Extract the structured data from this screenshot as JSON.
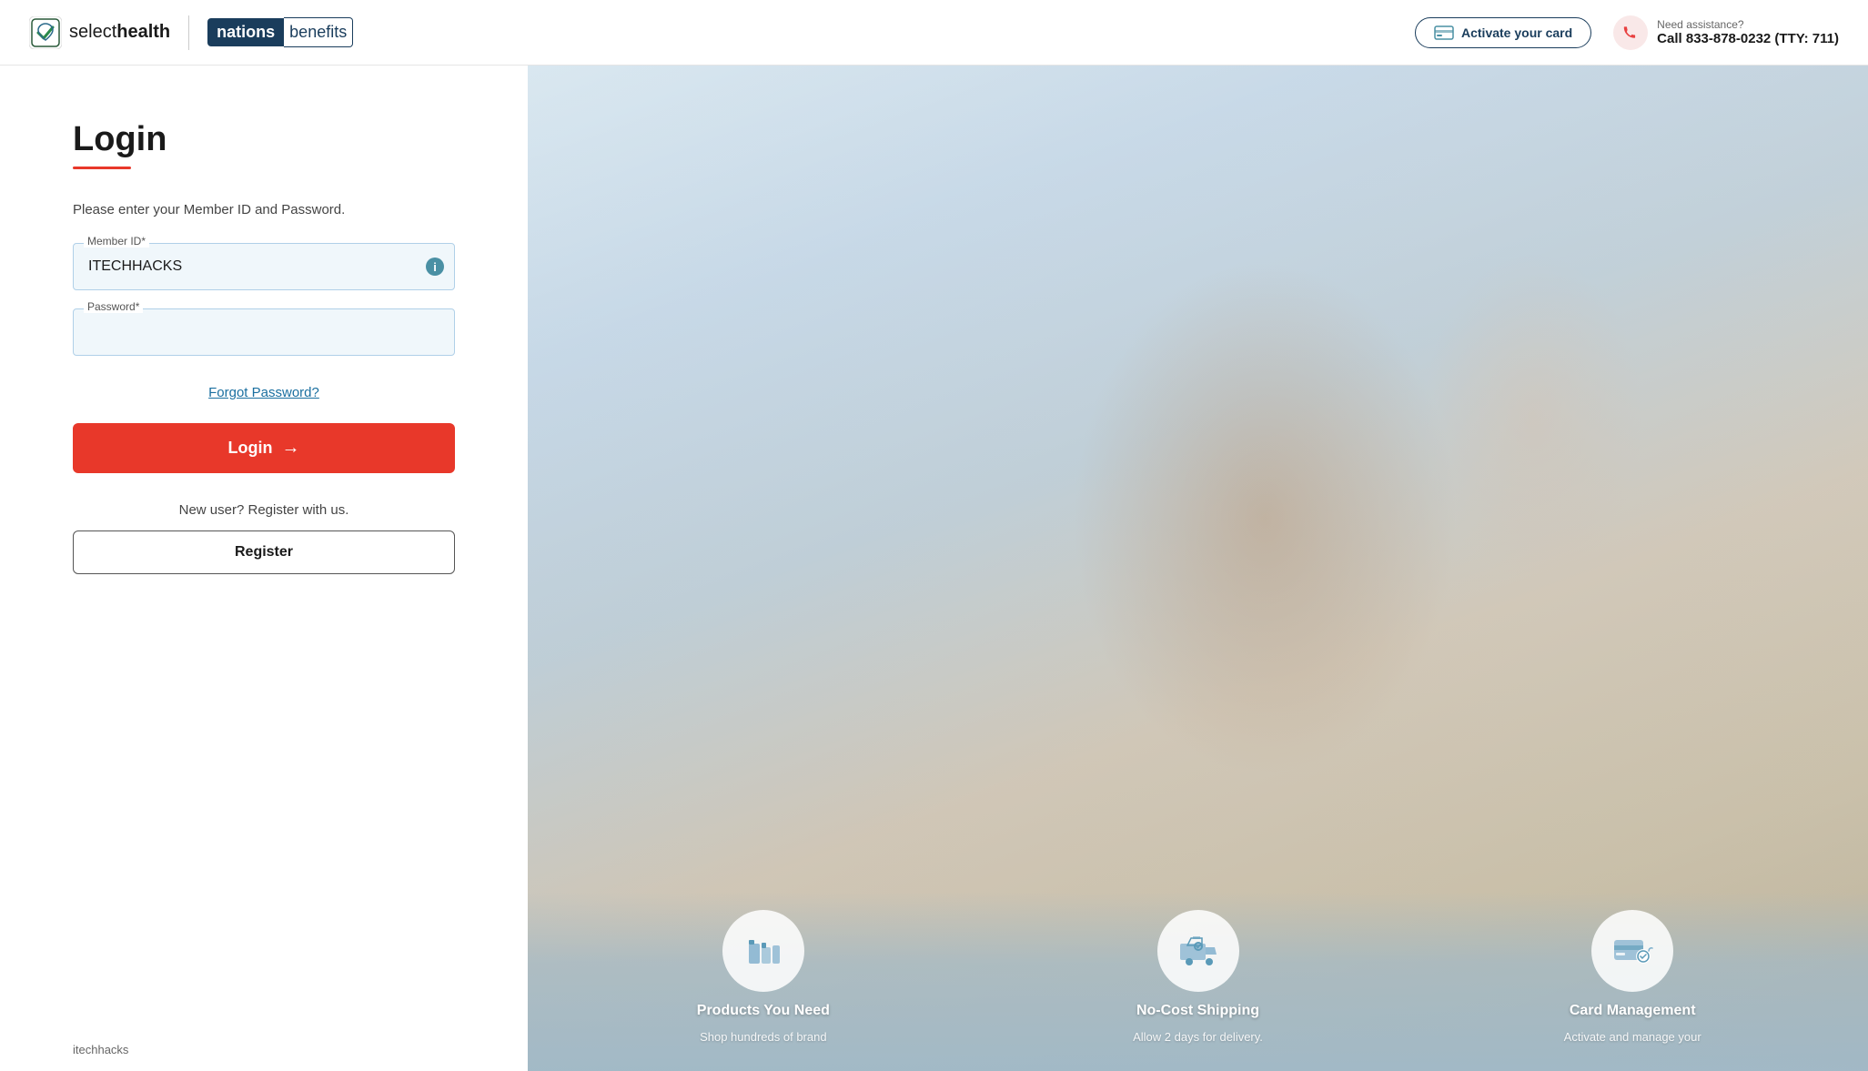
{
  "header": {
    "logo_select": "select",
    "logo_health": "health",
    "logo_nations": "nations",
    "logo_benefits": "benefits",
    "activate_card_label": "Activate your card",
    "assistance_label": "Need assistance?",
    "assistance_number": "Call  833-878-0232 (TTY: 711)"
  },
  "login": {
    "title": "Login",
    "subtitle": "Please enter your Member ID and Password.",
    "member_id_label": "Member ID*",
    "member_id_value": "ITECHHACKS",
    "password_label": "Password*",
    "password_placeholder": "",
    "forgot_password_label": "Forgot Password?",
    "login_button_label": "Login",
    "new_user_label": "New user? Register with us.",
    "register_button_label": "Register"
  },
  "footer": {
    "text": "itechhacks"
  },
  "features": [
    {
      "icon": "🛒",
      "title": "Products You Need",
      "desc": "Shop hundreds of brand"
    },
    {
      "icon": "🚚",
      "title": "No-Cost Shipping",
      "desc": "Allow 2 days for delivery."
    },
    {
      "icon": "💳",
      "title": "Card Management",
      "desc": "Activate and manage your"
    }
  ]
}
